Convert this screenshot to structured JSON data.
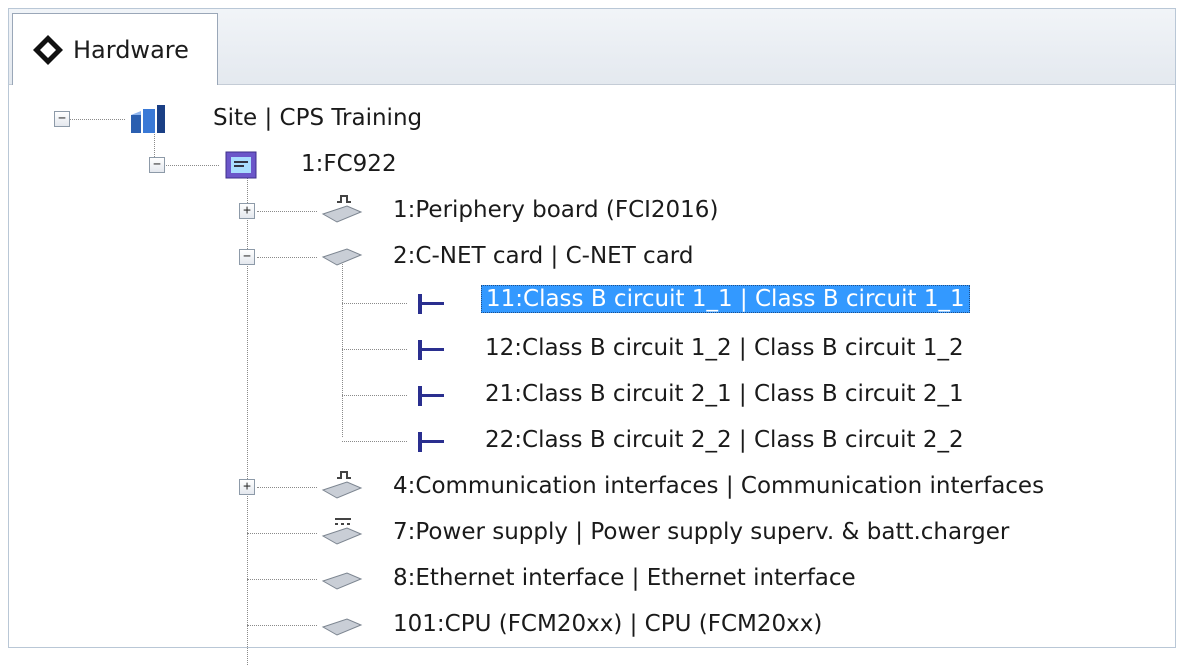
{
  "panel": {
    "tab_label": "Hardware",
    "tab_icon": "diamond-icon"
  },
  "tree": {
    "selected_color": "#3399ff",
    "nodes": [
      {
        "label": "Site | CPS Training",
        "icon": "site-icon",
        "expander": "−"
      },
      {
        "label": "1:FC922",
        "icon": "panel-icon",
        "expander": "−"
      },
      {
        "label": "1:Periphery board (FCI2016)",
        "icon": "board-icon",
        "expander": "+"
      },
      {
        "label": "2:C-NET card | C-NET card",
        "icon": "card-icon",
        "expander": "−"
      },
      {
        "label": "11:Class B circuit 1_1 | Class B circuit 1_1",
        "icon": "circuit-icon",
        "selected": true
      },
      {
        "label": "12:Class B circuit 1_2 | Class B circuit 1_2",
        "icon": "circuit-icon"
      },
      {
        "label": "21:Class B circuit 2_1 | Class B circuit 2_1",
        "icon": "circuit-icon"
      },
      {
        "label": "22:Class B circuit 2_2 | Class B circuit 2_2",
        "icon": "circuit-icon"
      },
      {
        "label": "4:Communication interfaces | Communication interfaces",
        "icon": "board-icon",
        "expander": "+"
      },
      {
        "label": "7:Power supply | Power supply superv. & batt.charger",
        "icon": "power-board-icon"
      },
      {
        "label": "8:Ethernet interface | Ethernet interface",
        "icon": "card-icon"
      },
      {
        "label": "101:CPU (FCM20xx) | CPU (FCM20xx)",
        "icon": "card-icon"
      }
    ]
  }
}
